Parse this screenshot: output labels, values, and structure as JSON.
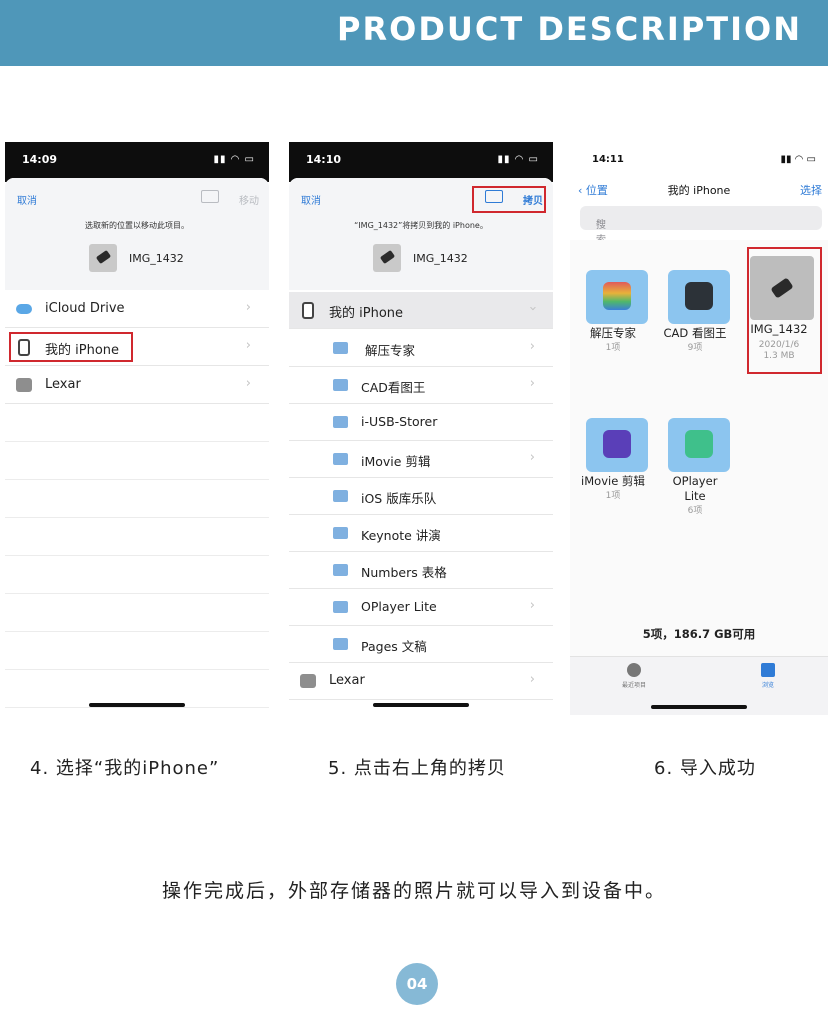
{
  "banner": {
    "title": "PRODUCT DESCRIPTION"
  },
  "step4": {
    "time": "14:09",
    "cancel": "取消",
    "move": "移动",
    "hint": "选取新的位置以移动此项目。",
    "file": "IMG_1432",
    "locations": [
      "iCloud Drive",
      "我的 iPhone",
      "Lexar"
    ],
    "caption": "4. 选择“我的iPhone”"
  },
  "step5": {
    "time": "14:10",
    "cancel": "取消",
    "copy": "拷贝",
    "hint": "“IMG_1432”将拷贝到我的 iPhone。",
    "file": "IMG_1432",
    "parent": "我的 iPhone",
    "folders": [
      "解压专家",
      "CAD看图王",
      "i-USB-Storer",
      "iMovie 剪辑",
      "iOS 版库乐队",
      "Keynote 讲演",
      "Numbers 表格",
      "OPlayer Lite",
      "Pages 文稿"
    ],
    "lexar": "Lexar",
    "caption": "5. 点击右上角的拷贝"
  },
  "step6": {
    "time": "14:11",
    "back": "位置",
    "title": "我的 iPhone",
    "select": "选择",
    "search_placeholder": "搜索",
    "items": [
      {
        "name": "解压专家",
        "meta": "1项"
      },
      {
        "name": "CAD 看图王",
        "meta": "9项"
      },
      {
        "name": "IMG_1432",
        "date": "2020/1/6",
        "size": "1.3 MB"
      },
      {
        "name": "iMovie 剪辑",
        "meta": "1项"
      },
      {
        "name": "OPlayer",
        "name2": "Lite",
        "meta": "6项"
      }
    ],
    "storage": "5项，186.7 GB可用",
    "tab_recent": "最近项目",
    "tab_browse": "浏览",
    "caption": "6. 导入成功"
  },
  "footer": "操作完成后，外部存储器的照片就可以导入到设备中。",
  "page_number": "04",
  "colors": {
    "banner": "#4f97b9",
    "ios_blue": "#2f7bd6",
    "highlight_red": "#d0282e"
  }
}
